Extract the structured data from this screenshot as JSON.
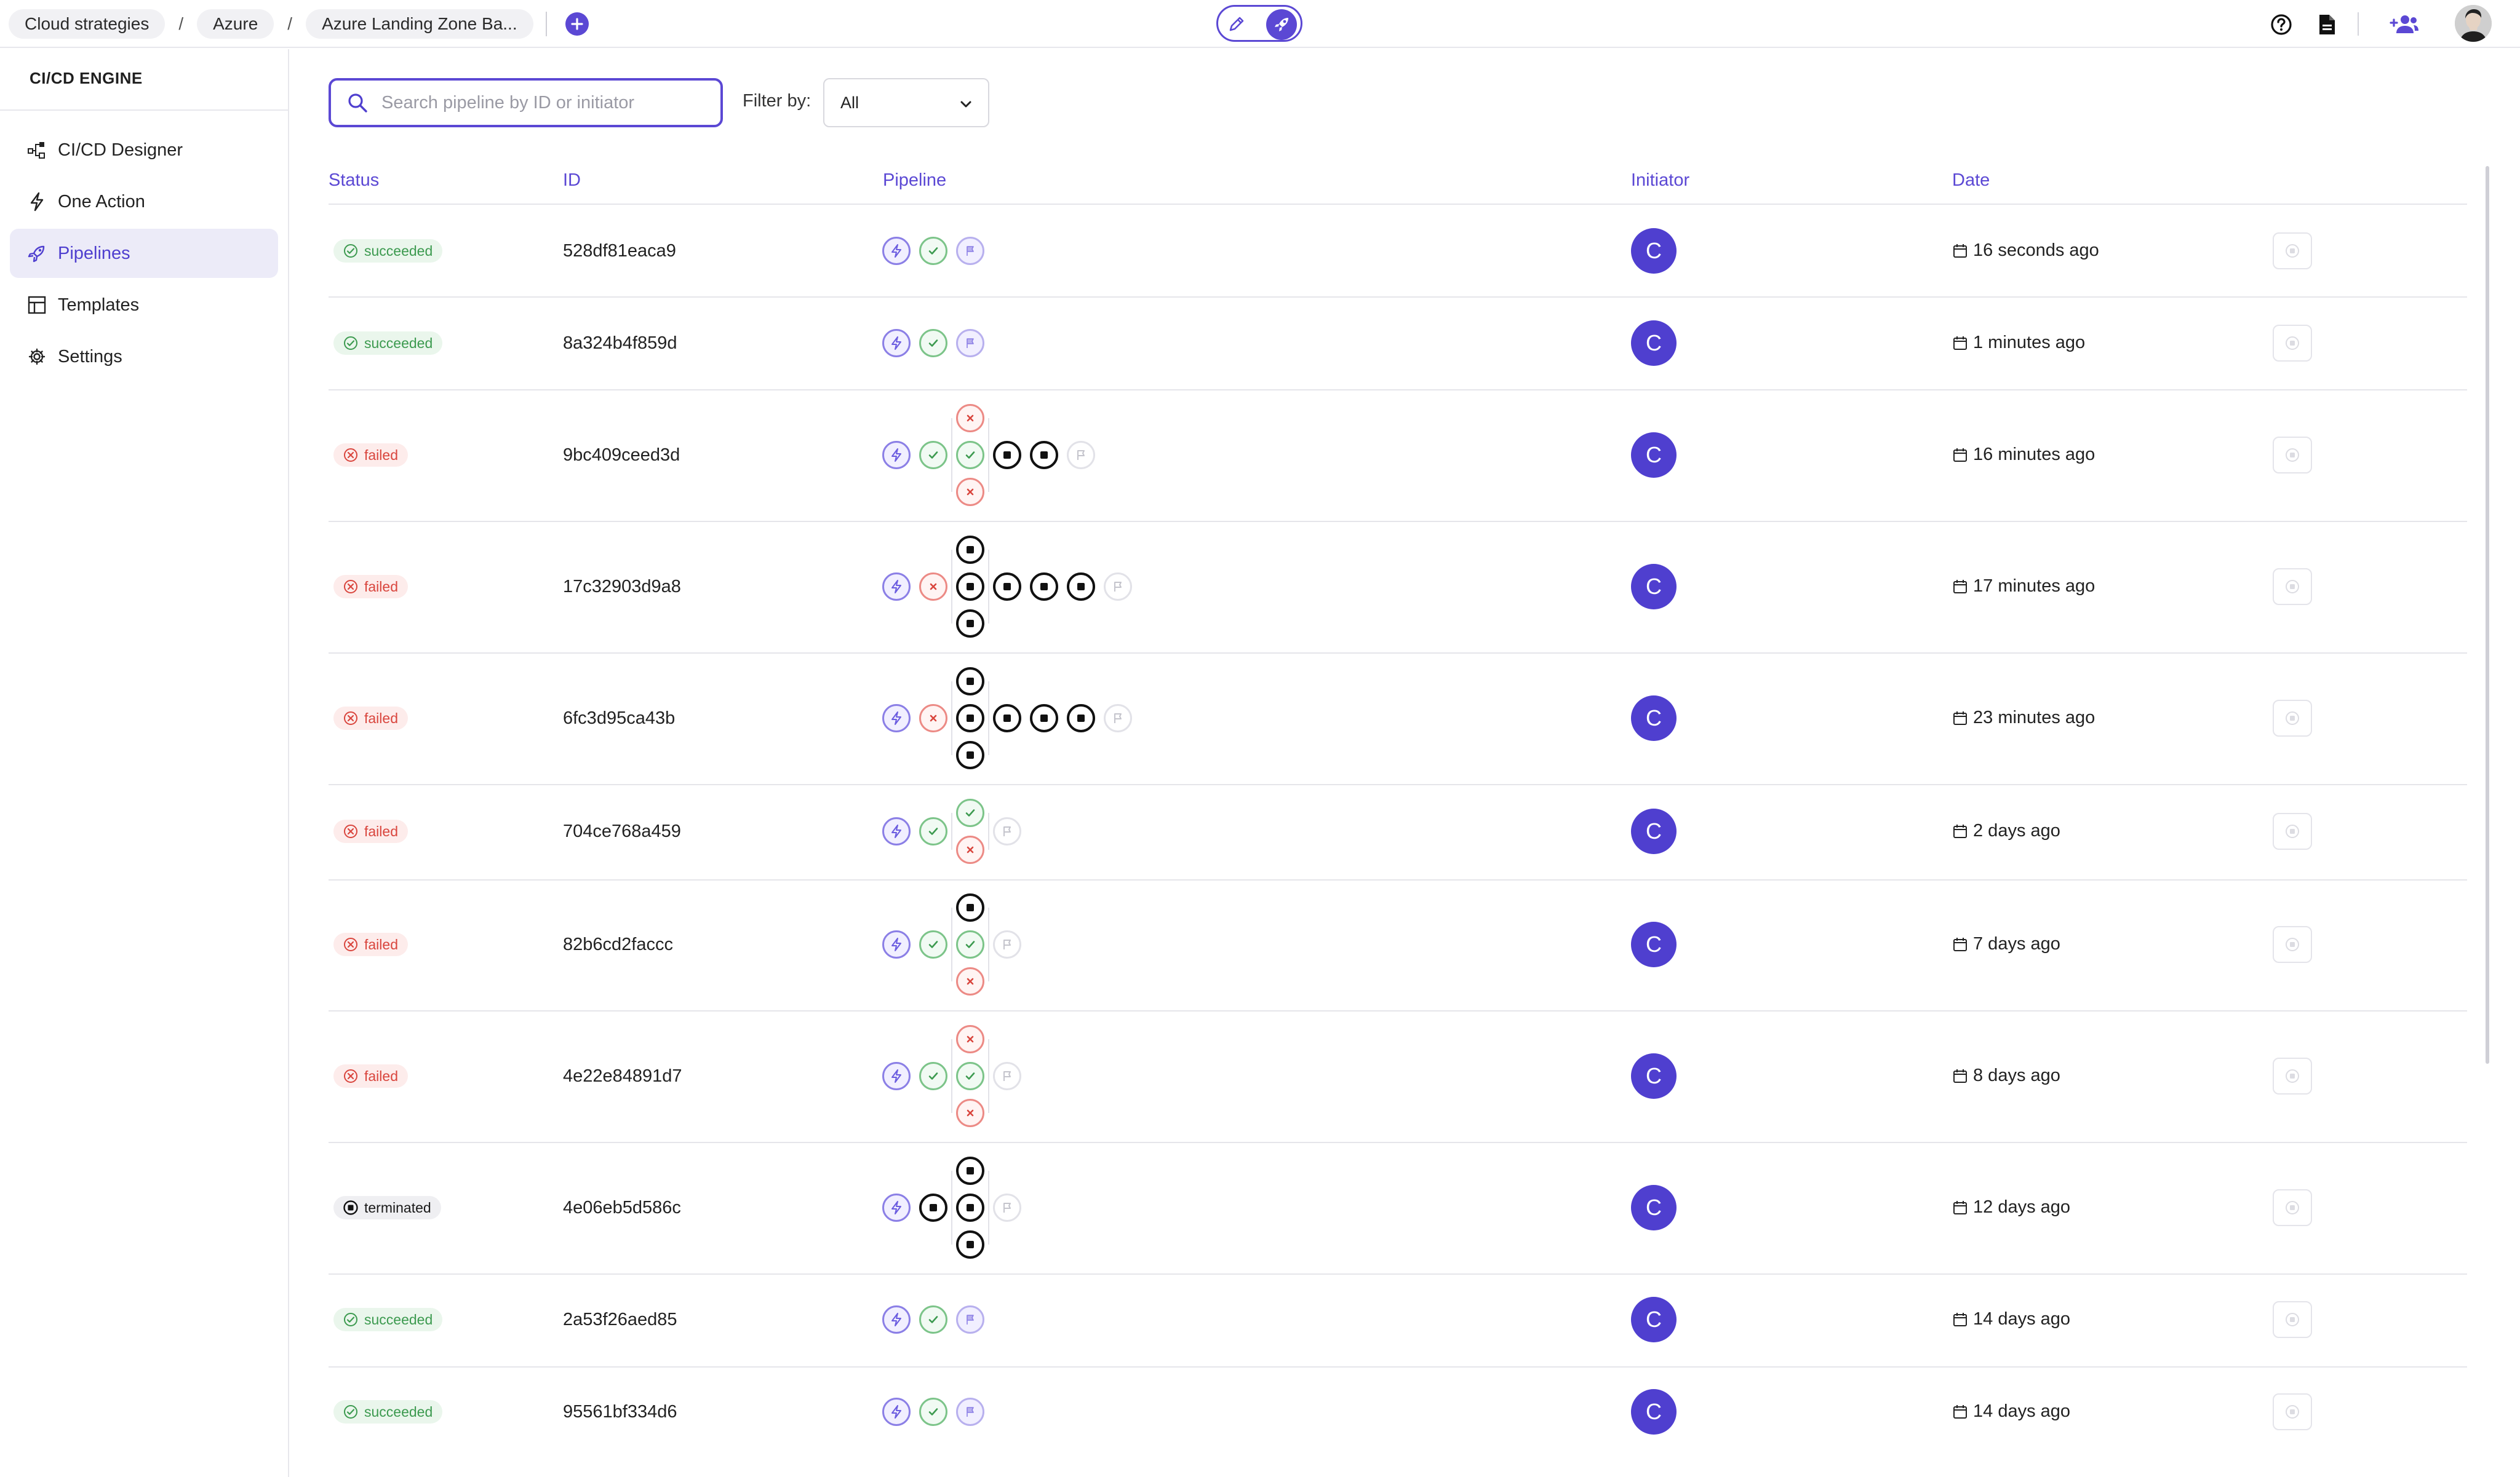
{
  "topbar": {
    "breadcrumbs": [
      "Cloud strategies",
      "Azure",
      "Azure Landing Zone Ba..."
    ],
    "separator": "/",
    "add_icon": "plus-circle-icon",
    "mode_icons": [
      "pencil-icon",
      "rocket-icon"
    ],
    "right_icons": [
      "help-icon",
      "document-icon",
      "team-icon"
    ],
    "accent_color": "#5b48d4"
  },
  "sidebar": {
    "title": "CI/CD ENGINE",
    "items": [
      {
        "label": "CI/CD Designer",
        "icon": "designer-icon",
        "active": false
      },
      {
        "label": "One Action",
        "icon": "lightning-icon",
        "active": false
      },
      {
        "label": "Pipelines",
        "icon": "rocket-icon",
        "active": true
      },
      {
        "label": "Templates",
        "icon": "template-icon",
        "active": false
      },
      {
        "label": "Settings",
        "icon": "gear-icon",
        "active": false
      }
    ]
  },
  "toolbar": {
    "search_placeholder": "Search pipeline by ID or initiator",
    "filter_label": "Filter by:",
    "filter_value": "All"
  },
  "table": {
    "headers": {
      "status": "Status",
      "id": "ID",
      "pipeline": "Pipeline",
      "initiator": "Initiator",
      "date": "Date"
    },
    "rows": [
      {
        "status": "succeeded",
        "id": "528df81eaca9",
        "initiator": "C",
        "date": "16 seconds ago"
      },
      {
        "status": "succeeded",
        "id": "8a324b4f859d",
        "initiator": "C",
        "date": "1 minutes ago"
      },
      {
        "status": "failed",
        "id": "9bc409ceed3d",
        "initiator": "C",
        "date": "16 minutes ago"
      },
      {
        "status": "failed",
        "id": "17c32903d9a8",
        "initiator": "C",
        "date": "17 minutes ago"
      },
      {
        "status": "failed",
        "id": "6fc3d95ca43b",
        "initiator": "C",
        "date": "23 minutes ago"
      },
      {
        "status": "failed",
        "id": "704ce768a459",
        "initiator": "C",
        "date": "2 days ago"
      },
      {
        "status": "failed",
        "id": "82b6cd2faccc",
        "initiator": "C",
        "date": "7 days ago"
      },
      {
        "status": "failed",
        "id": "4e22e84891d7",
        "initiator": "C",
        "date": "8 days ago"
      },
      {
        "status": "terminated",
        "id": "4e06eb5d586c",
        "initiator": "C",
        "date": "12 days ago"
      },
      {
        "status": "succeeded",
        "id": "2a53f26aed85",
        "initiator": "C",
        "date": "14 days ago"
      },
      {
        "status": "succeeded",
        "id": "95561bf334d6",
        "initiator": "C",
        "date": "14 days ago"
      }
    ]
  },
  "status_colors": {
    "succeeded": "#3c9a4f",
    "failed": "#d9453d",
    "terminated": "#1a1a1a"
  }
}
